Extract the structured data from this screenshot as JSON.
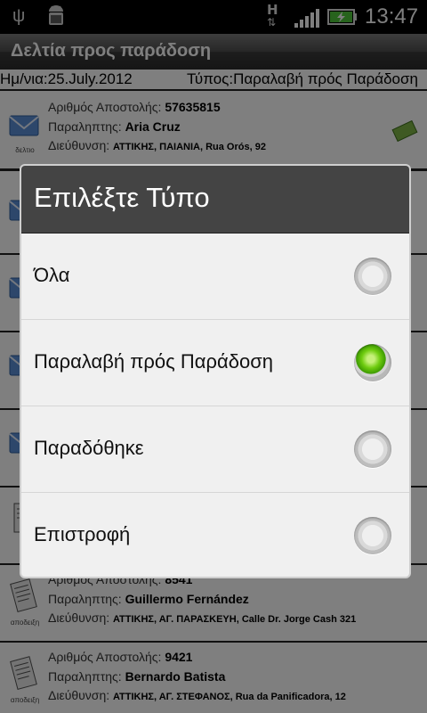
{
  "status_bar": {
    "clock": "13:47",
    "network": "H",
    "icons": [
      "usb-icon",
      "android-debug-icon",
      "h-network-icon",
      "signal-icon",
      "battery-charging-icon"
    ]
  },
  "titlebar": {
    "title": "Δελτία προς παράδοση"
  },
  "info": {
    "date": "Ημ/νια:25.July.2012",
    "type": "Τύπος:Παραλαβή πρός Παράδοση"
  },
  "list_rows": [
    {
      "label_number": "Αριθμός Αποστολής:",
      "number": "57635815",
      "label_recipient": "Παραληπτης:",
      "recipient": "Aria Cruz",
      "label_address": "Διεύθυνση:",
      "address": "ΑΤΤΙΚΗΣ, ΠΑΙΑΝΙΑ, Rua Orós, 92",
      "caption": "δελτιο",
      "icon": "envelope-icon"
    },
    {
      "label_number": "Αριθμός Αποστολής:",
      "number": "8541",
      "label_recipient": "Παραληπτης:",
      "recipient": "Guillermo Fernández",
      "label_address": "Διεύθυνση:",
      "address": "ΑΤΤΙΚΗΣ, ΑΓ. ΠΑΡΑΣΚΕΥΗ, Calle Dr. Jorge Cash 321",
      "caption": "αποδειξη",
      "icon": "receipt-icon"
    },
    {
      "label_number": "Αριθμός Αποστολής:",
      "number": "9421",
      "label_recipient": "Παραληπτης:",
      "recipient": "Bernardo Batista",
      "label_address": "Διεύθυνση:",
      "address": "ΑΤΤΙΚΗΣ, ΑΓ. ΣΤΕΦΑΝΟΣ, Rua da Panificadora, 12",
      "caption": "αποδειξη",
      "icon": "receipt-icon"
    }
  ],
  "dialog": {
    "title": "Επιλέξτε Τύπο",
    "options": [
      {
        "label": "Όλα",
        "checked": false
      },
      {
        "label": "Παραλαβή πρός Παράδοση",
        "checked": true
      },
      {
        "label": "Παραδόθηκε",
        "checked": false
      },
      {
        "label": "Επιστροφή",
        "checked": false
      }
    ]
  },
  "colors": {
    "accent_green": "#6fcc10",
    "dialog_header": "#444444",
    "title_bar": "#3a3a3a"
  }
}
